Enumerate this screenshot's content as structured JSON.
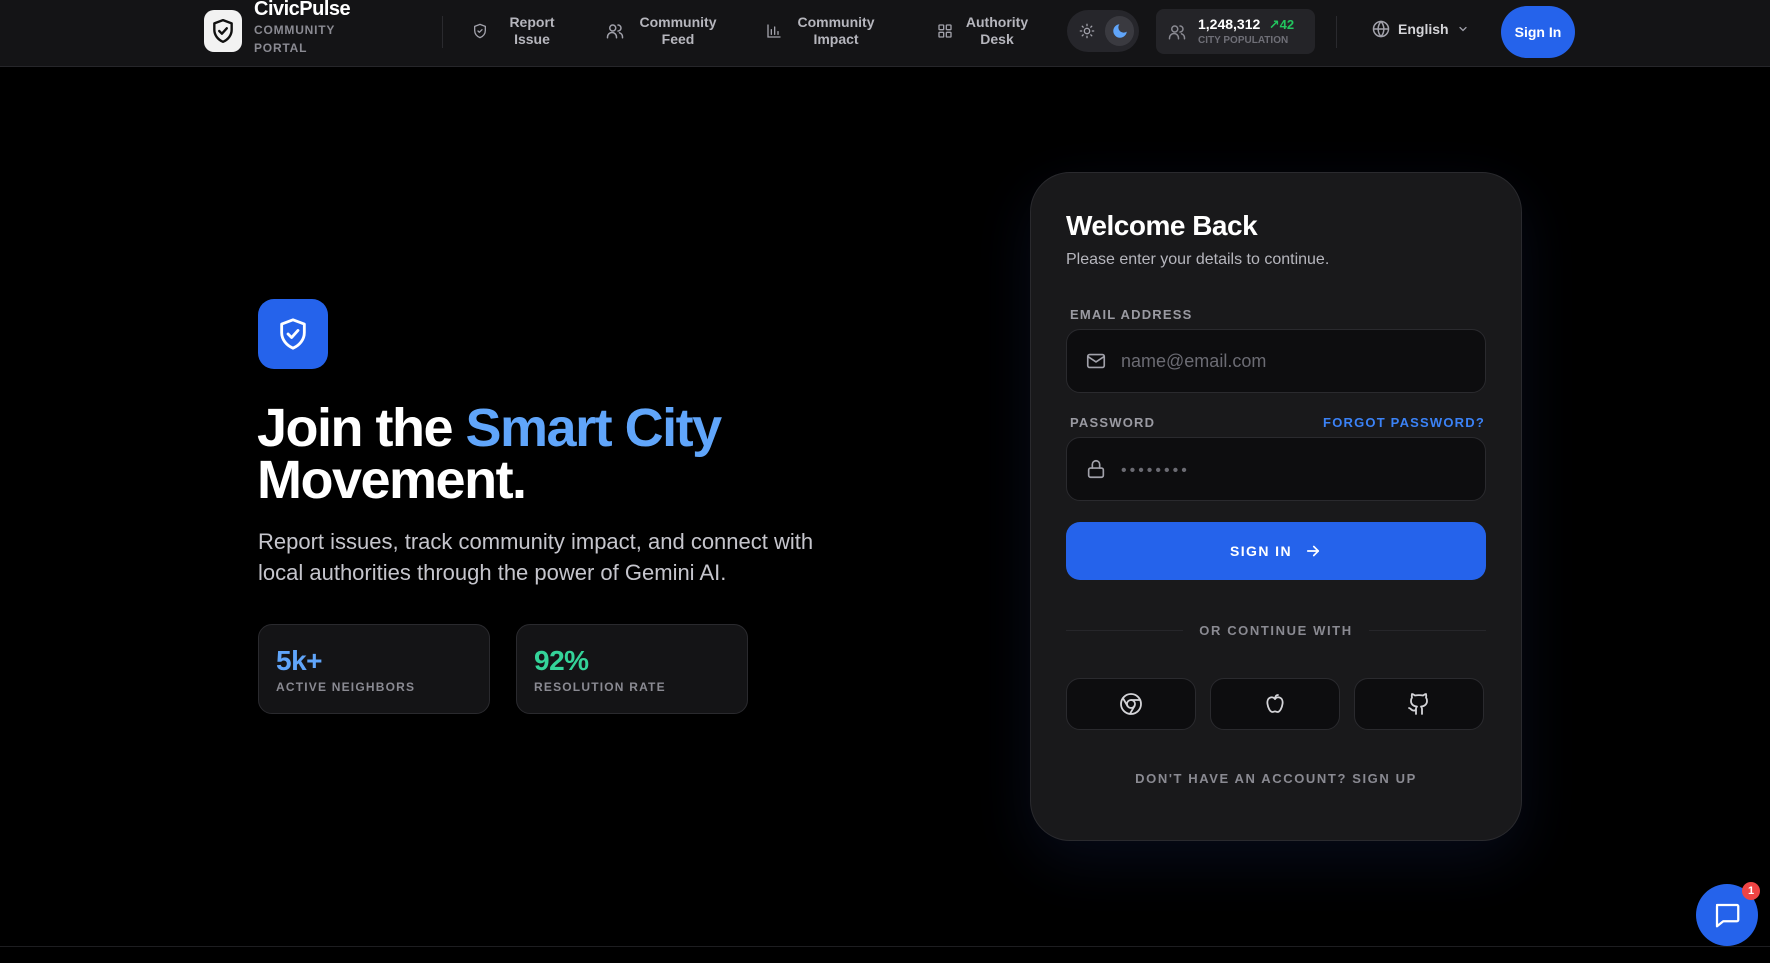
{
  "brand": {
    "name": "CivicPulse",
    "subtitle": "COMMUNITY PORTAL"
  },
  "nav": {
    "items": [
      {
        "label": "Report Issue",
        "icon": "shield-icon"
      },
      {
        "label": "Community Feed",
        "icon": "users-icon"
      },
      {
        "label": "Community Impact",
        "icon": "bar-chart-icon"
      },
      {
        "label": "Authority Desk",
        "icon": "grid-icon"
      }
    ],
    "theme": {
      "options": [
        "sun-icon",
        "moon-icon"
      ],
      "active": "moon-icon"
    },
    "population": {
      "value": "1,248,312",
      "delta": "42",
      "label": "CITY POPULATION"
    },
    "language": "English",
    "sign_in": "Sign In"
  },
  "hero": {
    "title_prefix": "Join the ",
    "title_accent": "Smart City",
    "title_suffix": "Movement.",
    "description": "Report issues, track community impact, and connect with local authorities through the power of Gemini AI.",
    "stats": [
      {
        "value": "5k+",
        "label": "ACTIVE NEIGHBORS",
        "color": "#60a5fa"
      },
      {
        "value": "92%",
        "label": "RESOLUTION RATE",
        "color": "#34d399"
      }
    ]
  },
  "login": {
    "title": "Welcome Back",
    "subtitle": "Please enter your details to continue.",
    "email_label": "EMAIL ADDRESS",
    "email_placeholder": "name@email.com",
    "password_label": "PASSWORD",
    "forgot": "FORGOT PASSWORD?",
    "password_placeholder": "••••••••",
    "submit": "SIGN IN",
    "divider": "OR CONTINUE WITH",
    "social": [
      "chrome-icon",
      "apple-icon",
      "github-icon"
    ],
    "signup": "DON'T HAVE AN ACCOUNT? SIGN UP"
  },
  "chat": {
    "badge": "1"
  },
  "colors": {
    "accent": "#2563eb",
    "accent_text": "#60a5fa",
    "success": "#22c55e",
    "danger": "#ef4444"
  }
}
